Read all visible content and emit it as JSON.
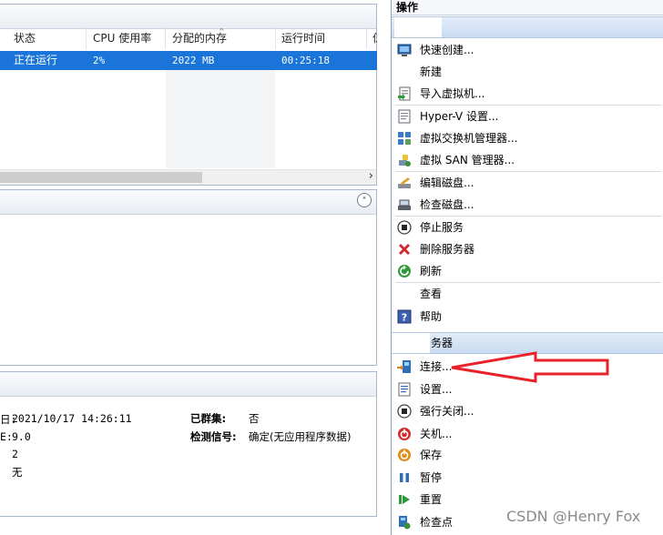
{
  "vm_list": {
    "columns": [
      "状态",
      "CPU 使用率",
      "分配的内存",
      "运行时间",
      "伢"
    ],
    "selected_row": {
      "state": "正在运行",
      "cpu": "2%",
      "memory": "2022 MB",
      "uptime": "00:25:18"
    },
    "scroll_right_glyph": "›"
  },
  "middle_pane": {
    "collapse_glyph": "˄"
  },
  "details": {
    "rows": [
      {
        "label": "日:",
        "value": "2021/10/17 14:26:11",
        "label2": "已群集:",
        "value2": "否"
      },
      {
        "label": "E:",
        "value": "9.0",
        "label2": "检测信号:",
        "value2": "确定(无应用程序数据)"
      },
      {
        "label": "",
        "value": "2",
        "label2": "",
        "value2": ""
      },
      {
        "label": "",
        "value": "无",
        "label2": "",
        "value2": ""
      }
    ]
  },
  "actions": {
    "title": "操作",
    "group1_header": "",
    "group1": [
      {
        "label": "快速创建...",
        "icon": "monitor-icon"
      },
      {
        "label": "新建",
        "icon": ""
      },
      {
        "label": "导入虚拟机...",
        "icon": "import-icon"
      },
      {
        "label": "Hyper-V 设置...",
        "icon": "settings-page-icon"
      },
      {
        "label": "虚拟交换机管理器...",
        "icon": "switch-icon"
      },
      {
        "label": "虚拟 SAN 管理器...",
        "icon": "san-icon"
      },
      {
        "label": "编辑磁盘...",
        "icon": "edit-disk-icon"
      },
      {
        "label": "检查磁盘...",
        "icon": "inspect-disk-icon"
      },
      {
        "label": "停止服务",
        "icon": "stop-icon"
      },
      {
        "label": "删除服务器",
        "icon": "delete-icon"
      },
      {
        "label": "刷新",
        "icon": "refresh-icon"
      },
      {
        "label": "查看",
        "icon": ""
      },
      {
        "label": "帮助",
        "icon": "help-icon"
      }
    ],
    "group2_header": "务器",
    "group2": [
      {
        "label": "连接...",
        "icon": "connect-icon"
      },
      {
        "label": "设置...",
        "icon": "settings-page-icon"
      },
      {
        "label": "强行关闭...",
        "icon": "stop-icon"
      },
      {
        "label": "关机...",
        "icon": "shutdown-icon"
      },
      {
        "label": "保存",
        "icon": "save-icon"
      },
      {
        "label": "暂停",
        "icon": "pause-icon"
      },
      {
        "label": "重置",
        "icon": "reset-icon"
      },
      {
        "label": "检查点",
        "icon": "checkpoint-icon"
      }
    ]
  },
  "watermark": "CSDN @Henry Fox",
  "colors": {
    "selection": "#1b75d9",
    "arrow": "#e8232a",
    "group_bar": "#c9dbf2"
  }
}
